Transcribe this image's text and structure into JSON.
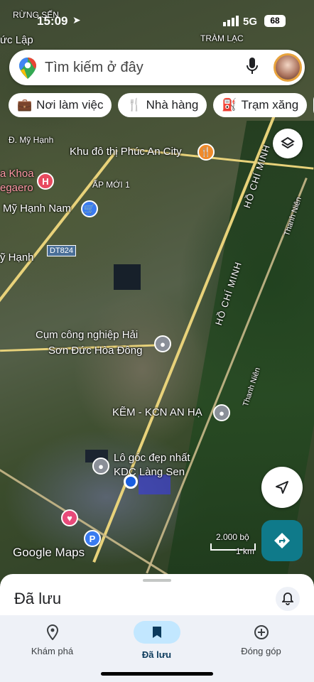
{
  "status": {
    "time": "15:09",
    "network": "5G",
    "battery": "68"
  },
  "search": {
    "placeholder": "Tìm kiếm ở đây"
  },
  "chips": [
    "Nơi làm việc",
    "Nhà hàng",
    "Trạm xăng"
  ],
  "map_labels": {
    "rung_sen": "RỪNG SẾN",
    "duc_lap": "ức Lập",
    "tram_lac": "TRÀM LẠC",
    "d_my_hanh": "Đ. Mỹ Hạnh",
    "khu_do_thi": "Khu đô thị Phúc An City",
    "khoa": "a Khoa",
    "gaero": "egaero",
    "ap_moi": "ẤP MỚI 1",
    "my_hanh_nam": "Mỹ Hạnh Nam",
    "dt824": "DT824",
    "y_hanh": "ỹ Hạnh",
    "ho_chi_minh_1": "HỒ CHÍ MINH",
    "ho_chi_minh_2": "HỒ CHÍ MINH",
    "thanh_nien_1": "Thanh Niên",
    "thanh_nien_2": "Thanh Niên",
    "cum_cn_1": "Cụm công nghiệp Hải",
    "cum_cn_2": "Sơn Đức Hòa Đông",
    "kem": "KẼM - KCN AN HẠ",
    "lo_goc_1": "Lô góc đẹp nhất",
    "lo_goc_2": "KDC Làng Sen",
    "google_maps": "Google Maps",
    "scale_ft": "2.000 bộ",
    "scale_km": "1 km"
  },
  "sheet": {
    "title": "Đã lưu"
  },
  "nav": {
    "explore": "Khám phá",
    "saved": "Đã lưu",
    "contribute": "Đóng góp"
  },
  "colors": {
    "accent": "#0b57d0",
    "directions": "#0f7a8a",
    "nav_active": "#c2e7ff"
  }
}
